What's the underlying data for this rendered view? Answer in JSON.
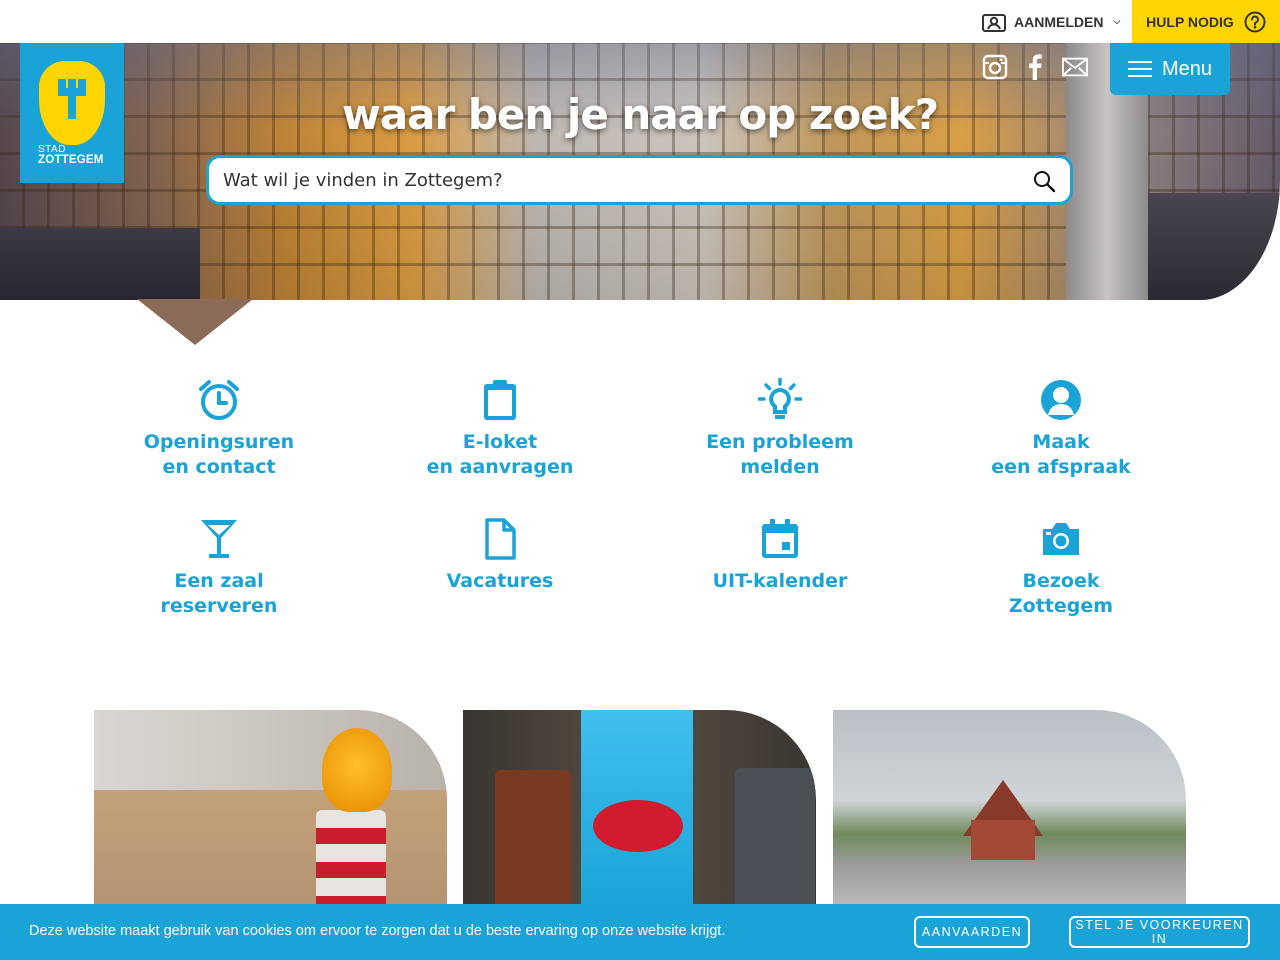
{
  "topbar": {
    "login_label": "AANMELDEN",
    "help_label": "HULP NODIG"
  },
  "logo": {
    "line1": "STAD",
    "line2": "ZOTTEGEM"
  },
  "social": [
    "instagram-icon",
    "facebook-icon",
    "mail-icon"
  ],
  "menu": {
    "label": "Menu"
  },
  "hero": {
    "heading": "waar ben je naar op zoek?",
    "search_placeholder": "Wat wil je vinden in Zottegem?"
  },
  "quick_links": [
    {
      "line1": "Openingsuren",
      "line2": "en contact",
      "icon": "clock-icon"
    },
    {
      "line1": "E-loket",
      "line2": "en aanvragen",
      "icon": "clipboard-icon"
    },
    {
      "line1": "Een probleem",
      "line2": "melden",
      "icon": "lightbulb-icon"
    },
    {
      "line1": "Maak",
      "line2": "een afspraak",
      "icon": "person-icon"
    },
    {
      "line1": "Een zaal",
      "line2": "reserveren",
      "icon": "cocktail-icon"
    },
    {
      "line1": "Vacatures",
      "line2": "",
      "icon": "document-icon"
    },
    {
      "line1": "UIT-kalender",
      "line2": "",
      "icon": "calendar-icon"
    },
    {
      "line1": "Bezoek",
      "line2": "Zottegem",
      "icon": "camera-icon"
    }
  ],
  "colors": {
    "accent": "#1aa3d6",
    "help_bg": "#ffd500"
  },
  "cookie": {
    "message": "Deze website maakt gebruik van cookies om ervoor te zorgen dat u de beste ervaring op onze website krijgt.",
    "accept_label": "AANVAARDEN",
    "prefs_label": "STEL JE VOORKEUREN IN"
  }
}
